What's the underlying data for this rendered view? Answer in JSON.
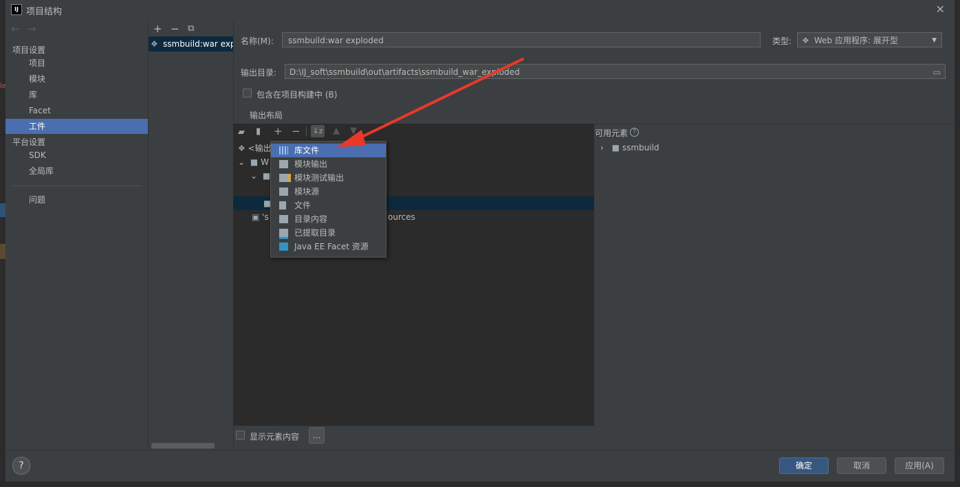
{
  "window": {
    "title": "项目结构"
  },
  "nav": {
    "section_project": "项目设置",
    "items_project": [
      "项目",
      "模块",
      "库",
      "Facet",
      "工件"
    ],
    "section_platform": "平台设置",
    "items_platform": [
      "SDK",
      "全局库"
    ],
    "problems": "问题"
  },
  "artifacts": {
    "selected": "ssmbuild:war exp"
  },
  "form": {
    "name_label": "名称(M):",
    "name_value": "ssmbuild:war exploded",
    "type_label": "类型:",
    "type_value": "Web 应用程序: 展开型",
    "output_label": "输出目录:",
    "output_value": "D:\\IJ_soft\\ssmbuild\\out\\artifacts\\ssmbuild_war_exploded",
    "include_in_build": "包含在项目构建中 (B)",
    "output_layout_tab": "输出布局"
  },
  "layout_tree": {
    "root": "<输出",
    "row_w": "W",
    "facet_row_prefix": "'s",
    "facet_row_suffix": "ources"
  },
  "add_menu": {
    "items": [
      "库文件",
      "模块输出",
      "模块测试输出",
      "模块源",
      "文件",
      "目录内容",
      "已提取目录",
      "Java EE Facet 资源"
    ]
  },
  "available": {
    "label": "可用元素",
    "help": "?",
    "item": "ssmbuild"
  },
  "show_content": {
    "label": "显示元素内容",
    "more": "..."
  },
  "buttons": {
    "ok": "确定",
    "cancel": "取消",
    "apply": "应用(A)",
    "help": "?"
  },
  "colors": {
    "selection": "#4b6eaf",
    "primary_button": "#365880",
    "arrow": "#e8392a"
  }
}
